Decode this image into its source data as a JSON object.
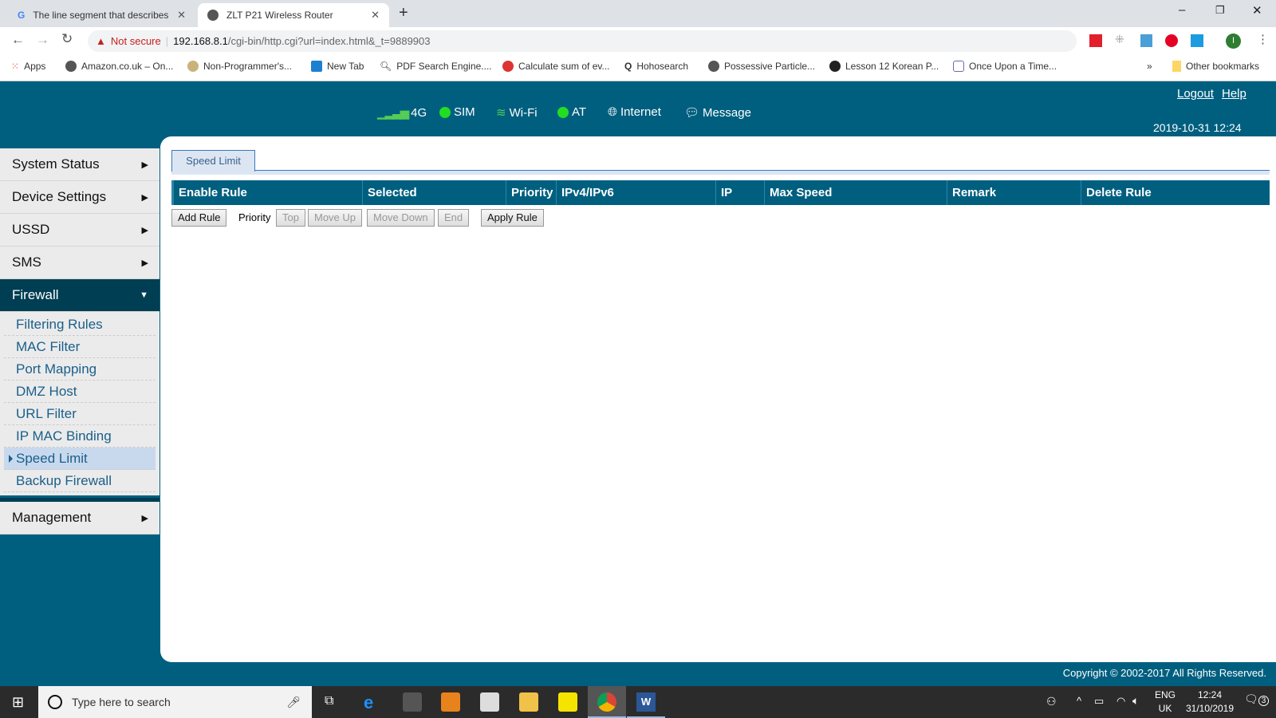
{
  "browser": {
    "tabs": [
      {
        "title": "The line segment that describes t",
        "active": false
      },
      {
        "title": "ZLT P21 Wireless Router",
        "active": true
      }
    ],
    "security": "Not secure",
    "url_host": "192.168.8.1",
    "url_path": "/cgi-bin/http.cgi?url=index.html&_t=9889903",
    "profile_initial": "I",
    "bookmarks": [
      "Apps",
      "Amazon.co.uk – On...",
      "Non-Programmer's...",
      "New Tab",
      "PDF Search Engine....",
      "Calculate sum of ev...",
      "Hohosearch",
      "Possessive Particle...",
      "Lesson 12 Korean P...",
      "Once Upon a Time..."
    ],
    "more": "»",
    "other_bookmarks": "Other bookmarks"
  },
  "header": {
    "status": {
      "network": "4G",
      "sim": "SIM",
      "wifi": "Wi-Fi",
      "at": "AT",
      "internet": "Internet",
      "message": "Message"
    },
    "logout": "Logout",
    "help": "Help",
    "datetime": "2019-10-31 12:24"
  },
  "sidebar": {
    "menu": [
      "System Status",
      "Device Settings",
      "USSD",
      "SMS"
    ],
    "firewall": "Firewall",
    "sub": [
      "Filtering Rules",
      "MAC Filter",
      "Port Mapping",
      "DMZ Host",
      "URL Filter",
      "IP MAC Binding",
      "Speed Limit",
      "Backup Firewall"
    ],
    "management": "Management"
  },
  "main": {
    "tab": "Speed Limit",
    "columns": [
      "Enable Rule",
      "Selected",
      "Priority",
      "IPv4/IPv6",
      "IP",
      "Max Speed",
      "Remark",
      "Delete Rule"
    ],
    "buttons": {
      "add": "Add Rule",
      "priority_label": "Priority",
      "top": "Top",
      "up": "Move Up",
      "down": "Move Down",
      "end": "End",
      "apply": "Apply Rule"
    }
  },
  "footer": "Copyright © 2002-2017 All Rights Reserved.",
  "taskbar": {
    "search": "Type here to search",
    "lang1": "ENG",
    "lang2": "UK",
    "time": "12:24",
    "date": "31/10/2019",
    "notifications": "3"
  }
}
